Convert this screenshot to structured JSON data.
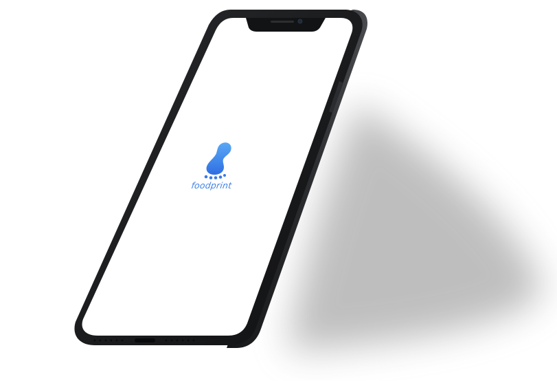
{
  "app": {
    "name": "foodprint"
  },
  "icons": {
    "logo": "footprint-logo-icon",
    "camera": "front-camera-icon",
    "speaker": "earpiece-speaker-icon",
    "port": "charging-port-icon"
  },
  "colors": {
    "brand_blue_light": "#5aa8f5",
    "brand_blue_dark": "#2f6fe3",
    "brand_text": "#3f83e6",
    "phone_frame": "#1c1d1f",
    "phone_edge": "#3a3b3e",
    "screen": "#ffffff",
    "shadow": "#8a8a8a"
  }
}
